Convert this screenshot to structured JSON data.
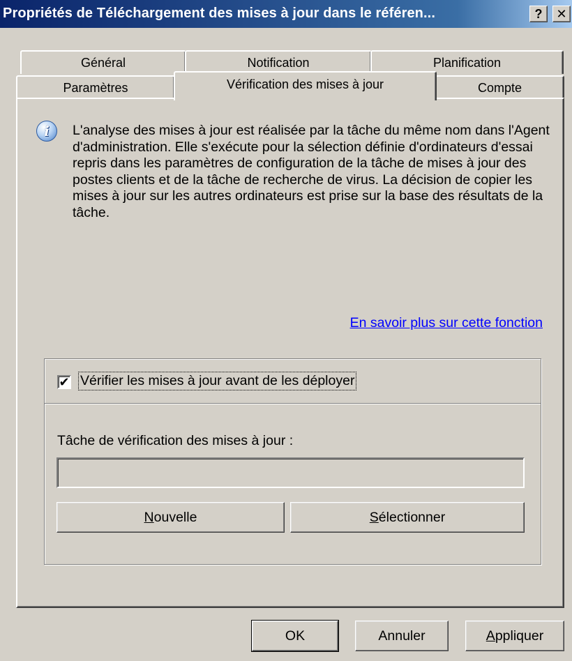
{
  "window": {
    "title": "Propriétés de Téléchargement des mises à jour dans le référen...",
    "help_label": "?",
    "close_label": "✕"
  },
  "tabs_back": [
    "Général",
    "Notification",
    "Planification"
  ],
  "tabs_front": [
    "Paramètres",
    "Vérification des mises à jour",
    "Compte"
  ],
  "active_tab": "Vérification des mises à jour",
  "info": {
    "icon": "info-icon",
    "icon_glyph": "i",
    "text": "L'analyse des mises à jour est réalisée par la tâche du même nom dans l'Agent d'administration. Elle s'exécute pour la sélection définie d'ordinateurs d'essai repris dans les paramètres de configuration de la tâche de mises à jour des postes clients et de la tâche de recherche de virus. La décision de copier les mises à jour sur les autres ordinateurs est prise sur la base des résultats de la tâche."
  },
  "learn_more_link": "En savoir plus sur cette fonction",
  "verify": {
    "checked": true,
    "check_glyph": "✔",
    "label": "Vérifier les mises à jour avant de les déployer",
    "task_label": "Tâche de vérification des mises à jour :",
    "task_value": "",
    "new_button": {
      "mnemonic": "N",
      "rest": "ouvelle"
    },
    "select_button": {
      "mnemonic": "S",
      "rest": "électionner"
    }
  },
  "footer": {
    "ok": "OK",
    "cancel": "Annuler",
    "apply": {
      "mnemonic": "A",
      "rest": "ppliquer"
    }
  }
}
